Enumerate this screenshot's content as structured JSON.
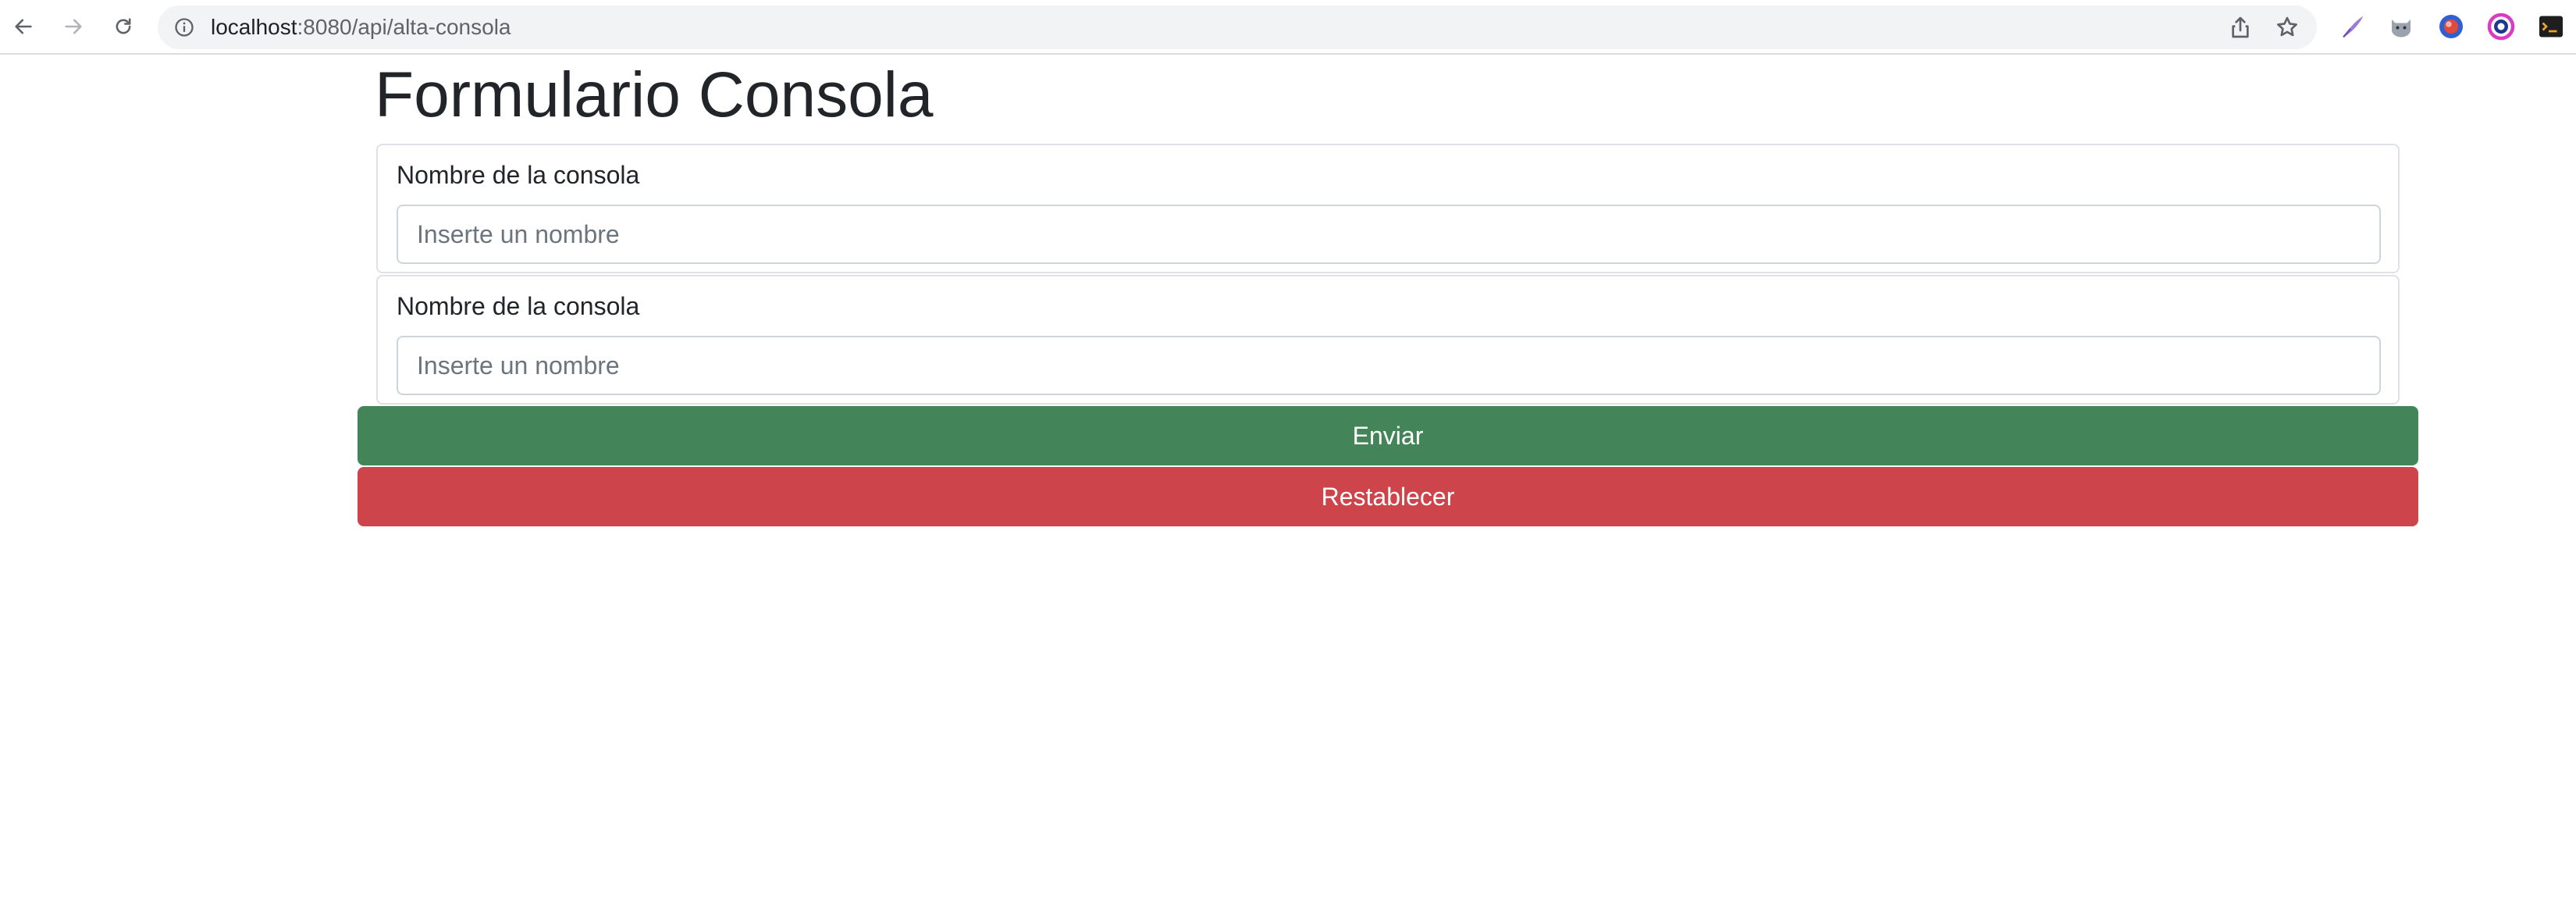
{
  "browser": {
    "url_host": "localhost",
    "url_path": ":8080/api/alta-consola",
    "nav_icons": [
      "back-arrow-icon",
      "forward-arrow-icon",
      "reload-icon"
    ],
    "omnibox_icons": [
      "site-info-icon",
      "share-icon",
      "bookmark-star-icon"
    ],
    "extension_icons": [
      "quill-extension-icon",
      "cat-extension-icon",
      "blue-orb-extension-icon",
      "color-ring-extension-icon",
      "terminal-extension-icon"
    ]
  },
  "page": {
    "title": "Formulario Consola"
  },
  "form": {
    "fields": [
      {
        "label": "Nombre de la consola",
        "value": "",
        "placeholder": "Inserte un nombre"
      },
      {
        "label": "Nombre de la consola",
        "value": "",
        "placeholder": "Inserte un nombre"
      }
    ],
    "submit_label": "Enviar",
    "reset_label": "Restablecer"
  },
  "colors": {
    "submit_bg": "#438459",
    "reset_bg": "#cd444b",
    "title_text": "#212529"
  }
}
